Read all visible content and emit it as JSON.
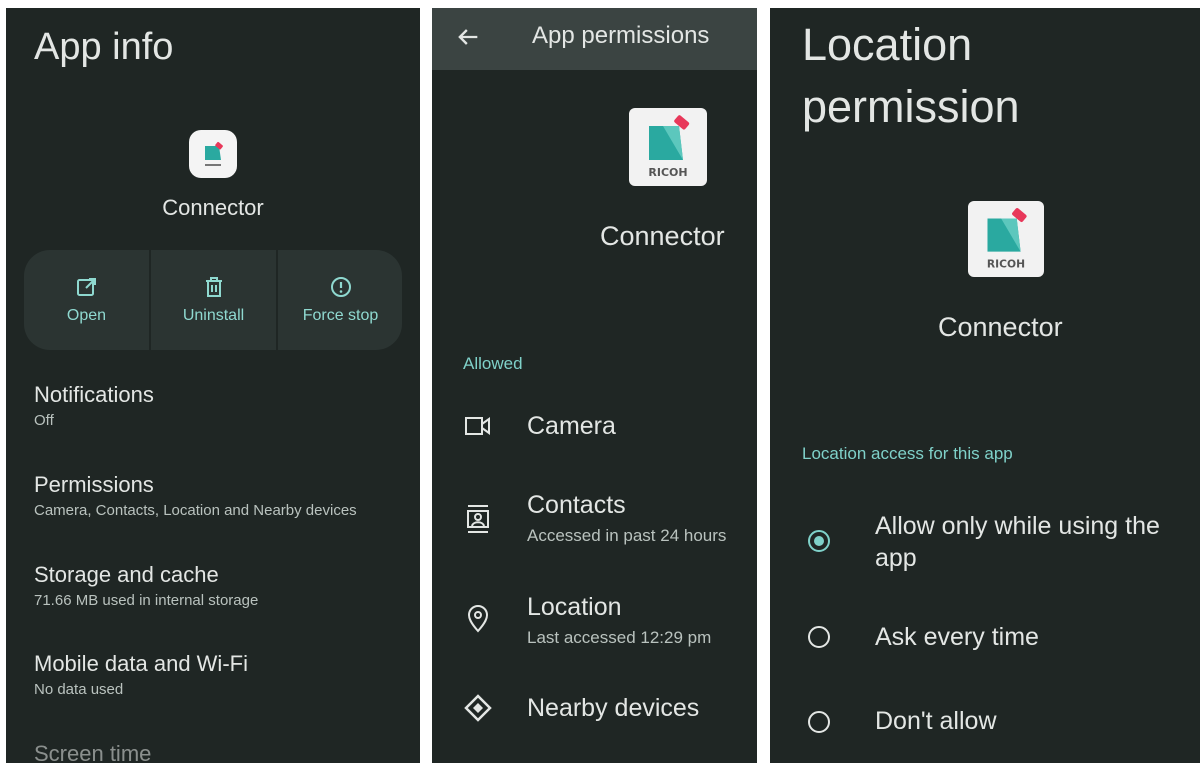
{
  "app_info": {
    "title": "App info",
    "app_name": "Connector",
    "actions": [
      {
        "label": "Open",
        "icon": "open-external-icon"
      },
      {
        "label": "Uninstall",
        "icon": "trash-icon"
      },
      {
        "label": "Force stop",
        "icon": "alert-circle-icon"
      }
    ],
    "settings": [
      {
        "title": "Notifications",
        "subtitle": "Off"
      },
      {
        "title": "Permissions",
        "subtitle": "Camera, Contacts, Location and Nearby devices"
      },
      {
        "title": "Storage and cache",
        "subtitle": "71.66 MB used in internal storage"
      },
      {
        "title": "Mobile data and Wi-Fi",
        "subtitle": "No data used"
      },
      {
        "title": "Screen time",
        "subtitle": ""
      }
    ]
  },
  "app_permissions": {
    "title": "App permissions",
    "app_name": "Connector",
    "logo_text": "RICOH",
    "section": "Allowed",
    "items": [
      {
        "title": "Camera",
        "subtitle": "",
        "icon": "camera-icon"
      },
      {
        "title": "Contacts",
        "subtitle": "Accessed in past 24 hours",
        "icon": "contacts-icon"
      },
      {
        "title": "Location",
        "subtitle": "Last accessed 12:29 pm",
        "icon": "location-pin-icon"
      },
      {
        "title": "Nearby devices",
        "subtitle": "",
        "icon": "nearby-devices-icon"
      }
    ]
  },
  "location_permission": {
    "title_line1": "Location",
    "title_line2": "permission",
    "app_name": "Connector",
    "logo_text": "RICOH",
    "section": "Location access for this app",
    "options": [
      {
        "label": "Allow only while using the app",
        "selected": true
      },
      {
        "label": "Ask every time",
        "selected": false
      },
      {
        "label": "Don't allow",
        "selected": false
      }
    ]
  },
  "colors": {
    "background": "#1f2624",
    "accent": "#7fd1c9",
    "card": "#2b3432",
    "toolbar": "#3b4442"
  }
}
